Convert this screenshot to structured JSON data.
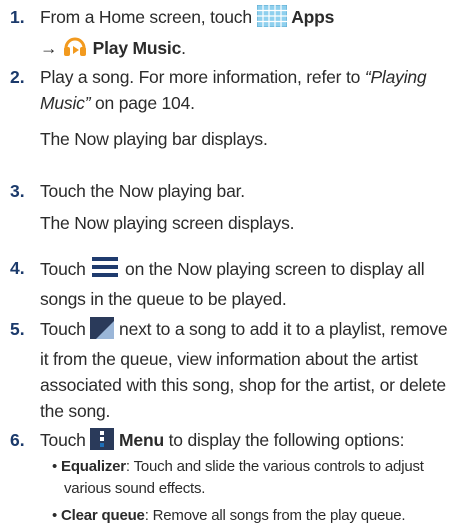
{
  "steps": [
    {
      "num": "1.",
      "a": "From a Home screen, touch",
      "apps": "Apps",
      "arrow": "→",
      "play_music": "Play Music",
      "end": "."
    },
    {
      "num": "2.",
      "a": "Play a song. For more information, refer to",
      "link": "“Playing Music”",
      "b": " on page 104.",
      "sub": "The Now playing bar displays."
    },
    {
      "num": "3.",
      "a": "Touch the Now playing bar.",
      "sub": "The Now playing screen displays."
    },
    {
      "num": "4.",
      "a": "Touch",
      "b": "on the Now playing screen to display all",
      "c": "songs in the queue to be played."
    },
    {
      "num": "5.",
      "a": "Touch",
      "b": "next to a song to add it to a playlist, remove",
      "c": "it from the queue, view information about the artist",
      "d": "associated with this song, shop for the artist, or delete",
      "e": "the song."
    },
    {
      "num": "6.",
      "a": "Touch",
      "menu": "Menu",
      "b": "to display the following options:"
    }
  ],
  "options": [
    {
      "bullet": "•",
      "term": "Equalizer",
      "sep": ": ",
      "desc1": "Touch and slide the various controls to adjust",
      "desc2": "various sound effects."
    },
    {
      "bullet": "•",
      "term": "Clear queue",
      "sep": ":  ",
      "desc1": "Remove all songs from the play queue."
    }
  ],
  "colors": {
    "step_number": "#1b3a6b",
    "apps_icon": "#8fd0ee",
    "play_music_icon": "#f29a1f",
    "queue_icon": "#1f3b6e",
    "overflow_icon": "#2a3a5a",
    "menu_icon": "#1e6fb8"
  },
  "icons": [
    "apps-grid-icon",
    "play-music-headphones-icon",
    "queue-list-icon",
    "overflow-triangle-icon",
    "menu-dots-icon"
  ]
}
